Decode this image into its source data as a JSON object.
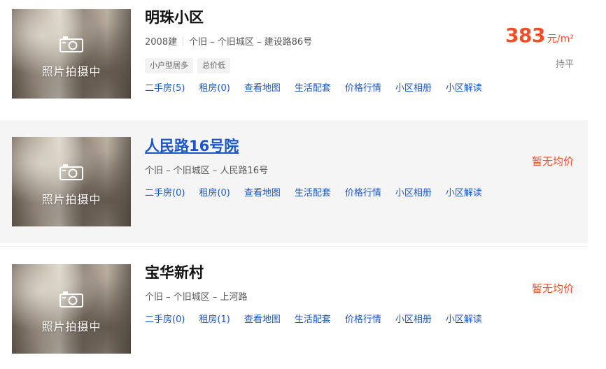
{
  "items": [
    {
      "thumb_label": "照片拍摄中",
      "name": "明珠小区",
      "meta_year": "2008建",
      "meta_location": "个旧 – 个旧城区 – 建设路86号",
      "tags": [
        "小户型居多",
        "总价低"
      ],
      "links": [
        "二手房(5)",
        "租房(0)",
        "查看地图",
        "生活配套",
        "价格行情",
        "小区相册",
        "小区解读"
      ],
      "price": "383",
      "price_unit": "元/m²",
      "trend": "持平"
    },
    {
      "thumb_label": "照片拍摄中",
      "name": "人民路16号院",
      "meta_location": "个旧 – 个旧城区 – 人民路16号",
      "links": [
        "二手房(0)",
        "租房(0)",
        "查看地图",
        "生活配套",
        "价格行情",
        "小区相册",
        "小区解读"
      ],
      "price_text": "暂无均价"
    },
    {
      "thumb_label": "照片拍摄中",
      "name": "宝华新村",
      "meta_location": "个旧 – 个旧城区 – 上河路",
      "links": [
        "二手房(0)",
        "租房(1)",
        "查看地图",
        "生活配套",
        "价格行情",
        "小区相册",
        "小区解读"
      ],
      "price_text": "暂无均价"
    }
  ],
  "colors": {
    "accent": "#f04d28",
    "link": "#1a56c8",
    "highlight_bg": "#f5f5f5"
  },
  "icons": {
    "thumb": "camera-icon"
  }
}
